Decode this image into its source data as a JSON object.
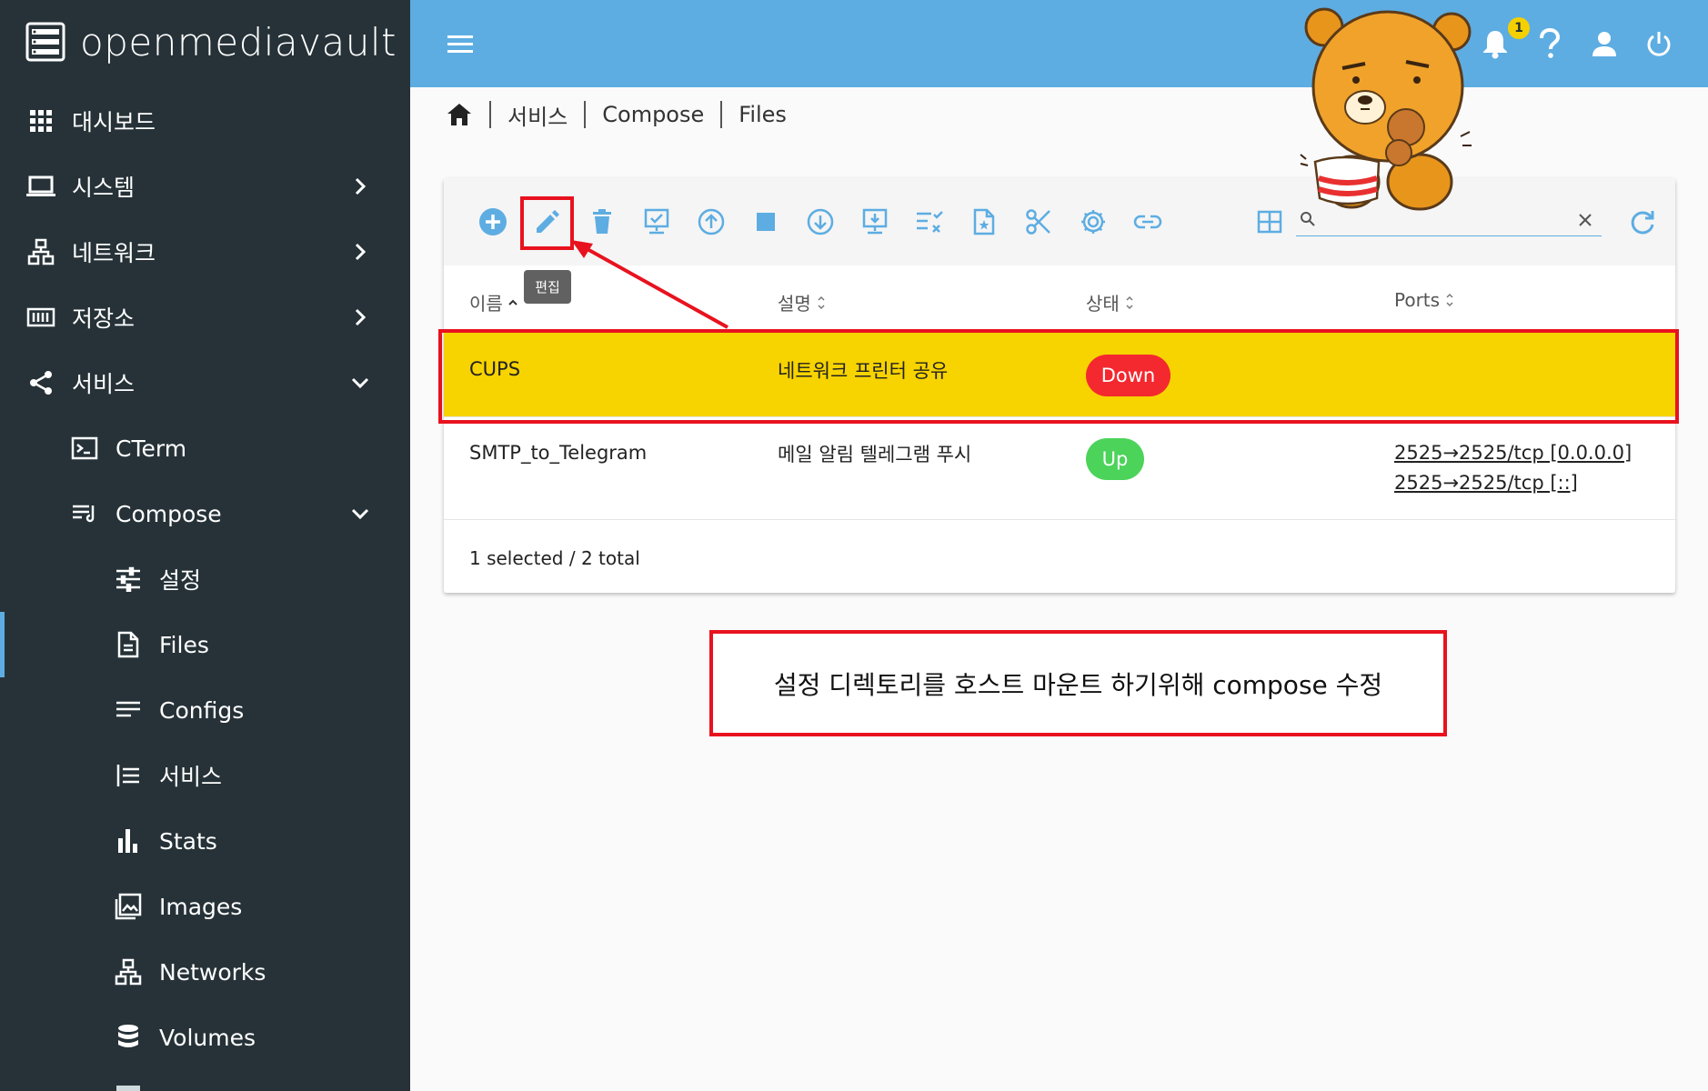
{
  "app": {
    "brand": "openmediavault"
  },
  "sidebar": {
    "items": [
      {
        "label": "대시보드",
        "icon": "dashboard-grid-icon"
      },
      {
        "label": "시스템",
        "icon": "laptop-icon"
      },
      {
        "label": "네트워크",
        "icon": "network-icon"
      },
      {
        "label": "저장소",
        "icon": "storage-icon"
      },
      {
        "label": "서비스",
        "icon": "share-icon"
      },
      {
        "label": "CTerm",
        "icon": "terminal-icon"
      },
      {
        "label": "Compose",
        "icon": "compose-icon"
      },
      {
        "label": "설정",
        "icon": "tune-icon"
      },
      {
        "label": "Files",
        "icon": "file-icon"
      },
      {
        "label": "Configs",
        "icon": "lines-icon"
      },
      {
        "label": "서비스",
        "icon": "list-icon"
      },
      {
        "label": "Stats",
        "icon": "bar-chart-icon"
      },
      {
        "label": "Images",
        "icon": "images-icon"
      },
      {
        "label": "Networks",
        "icon": "network-icon"
      },
      {
        "label": "Volumes",
        "icon": "database-icon"
      }
    ]
  },
  "topbar": {
    "notification_count": "1"
  },
  "breadcrumb": {
    "items": [
      "서비스",
      "Compose",
      "Files"
    ]
  },
  "toolbar": {
    "edit_tooltip": "편집",
    "search_placeholder": ""
  },
  "table": {
    "headers": [
      "이름",
      "설명",
      "상태",
      "Ports"
    ],
    "rows": [
      {
        "name": "CUPS",
        "description": "네트워크 프린터 공유",
        "status": "Down",
        "ports": []
      },
      {
        "name": "SMTP_to_Telegram",
        "description": "메일 알림 텔레그램 푸시",
        "status": "Up",
        "ports": [
          "2525→2525/tcp [0.0.0.0]",
          "2525→2525/tcp [::]"
        ]
      }
    ],
    "footer": "1 selected / 2 total"
  },
  "annotation": {
    "note": "설정 디렉토리를 호스트 마운트 하기위해 compose 수정"
  },
  "colors": {
    "sidebar_bg": "#263238",
    "accent": "#5dade2",
    "selected_row": "#f7d300",
    "status_down": "#f4282f",
    "status_up": "#4cd35a",
    "annotation_red": "#e8121e"
  }
}
